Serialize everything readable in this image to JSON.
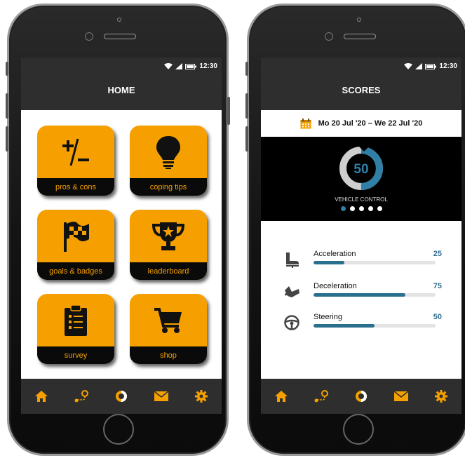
{
  "colors": {
    "accent": "#f5a000",
    "dark": "#2e2e2e",
    "blue": "#2f7fa6"
  },
  "home": {
    "status": {
      "time": "12:30"
    },
    "title": "HOME",
    "tiles": [
      {
        "label": "pros & cons",
        "icon": "plus-minus-icon"
      },
      {
        "label": "coping tips",
        "icon": "lightbulb-icon"
      },
      {
        "label": "goals & badges",
        "icon": "checkered-flag-icon"
      },
      {
        "label": "leaderboard",
        "icon": "trophy-icon"
      },
      {
        "label": "survey",
        "icon": "clipboard-icon"
      },
      {
        "label": "shop",
        "icon": "shopping-cart-icon"
      }
    ],
    "nav": [
      "home-icon",
      "route-icon",
      "scores-icon",
      "mail-icon",
      "settings-icon"
    ]
  },
  "scores": {
    "status": {
      "time": "12:30"
    },
    "title": "SCORES",
    "date_range": "Mo 20 Jul '20 – We 22 Jul '20",
    "gauge": {
      "value": 50,
      "fraction": 0.5,
      "label": "VEHICLE CONTROL"
    },
    "pager": {
      "count": 5,
      "active": 0
    },
    "metrics": [
      {
        "name": "Acceleration",
        "value": "25",
        "fraction": 0.25,
        "icon": "accelerator-pedal-icon"
      },
      {
        "name": "Deceleration",
        "value": "75",
        "fraction": 0.75,
        "icon": "brake-pedal-icon"
      },
      {
        "name": "Steering",
        "value": "50",
        "fraction": 0.5,
        "icon": "steering-wheel-icon"
      }
    ],
    "nav": [
      "home-icon",
      "route-icon",
      "scores-icon",
      "mail-icon",
      "settings-icon"
    ]
  }
}
